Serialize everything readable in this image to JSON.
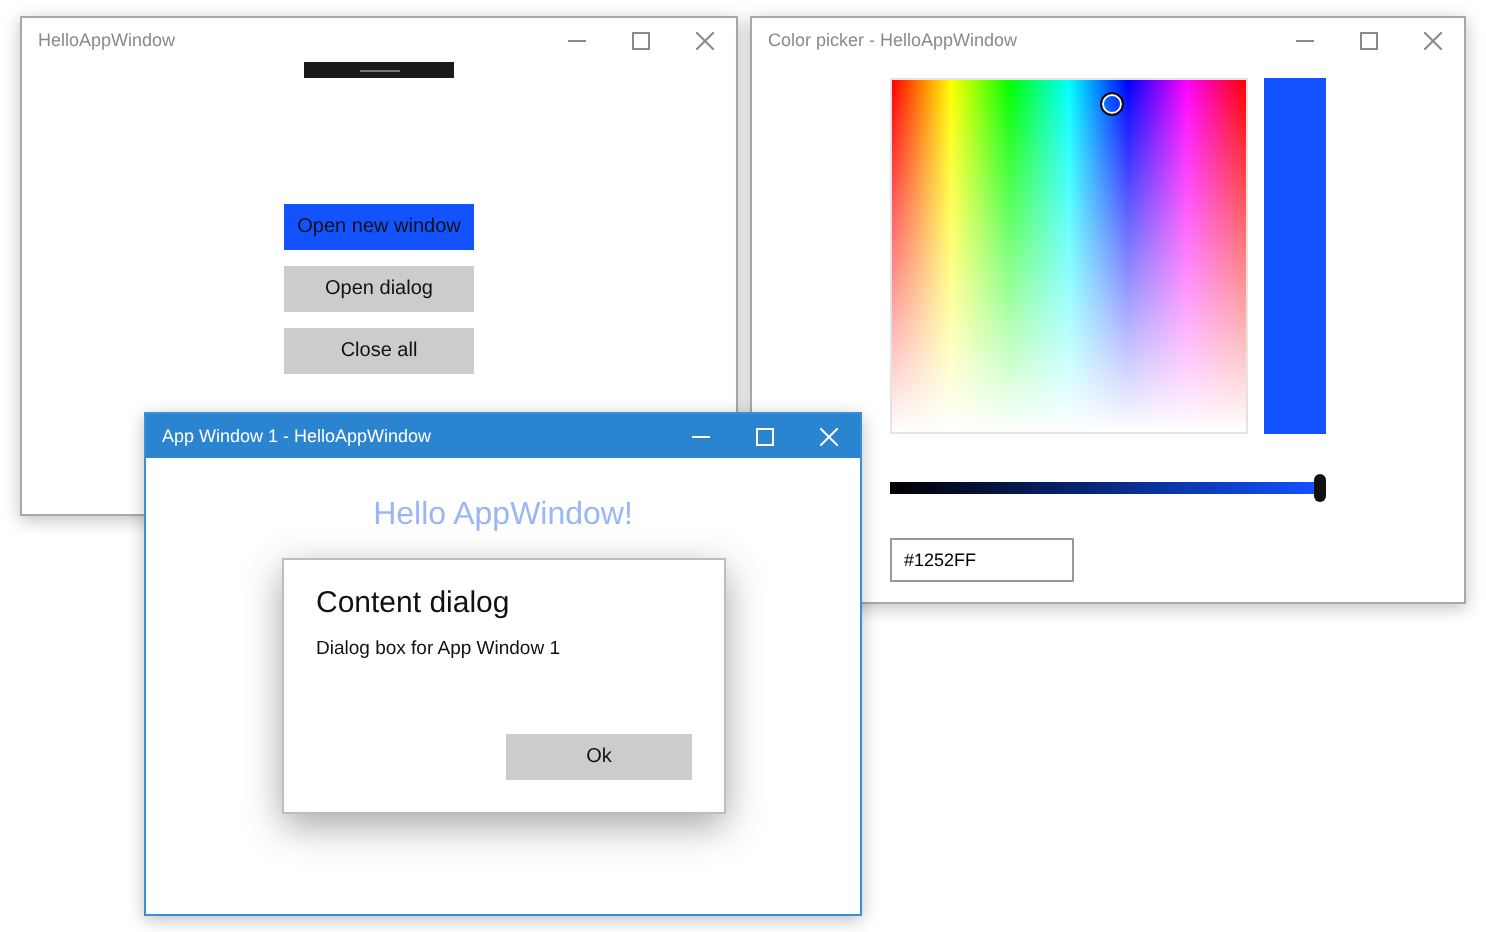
{
  "main_window": {
    "title": "HelloAppWindow",
    "active": false,
    "buttons": [
      {
        "label": "Open new window",
        "kind": "accent"
      },
      {
        "label": "Open dialog",
        "kind": "default"
      },
      {
        "label": "Close all",
        "kind": "default"
      }
    ]
  },
  "color_picker_window": {
    "title": "Color picker - HelloAppWindow",
    "active": false,
    "brightness": {
      "level": 1
    },
    "hex_field": {
      "value": "#1252FF"
    }
  },
  "app_window": {
    "title": "App Window 1 - HelloAppWindow",
    "active": true,
    "heading": "Hello AppWindow!",
    "dialog": {
      "title": "Content dialog",
      "text": "Dialog box for App Window 1",
      "button": "Ok"
    }
  }
}
